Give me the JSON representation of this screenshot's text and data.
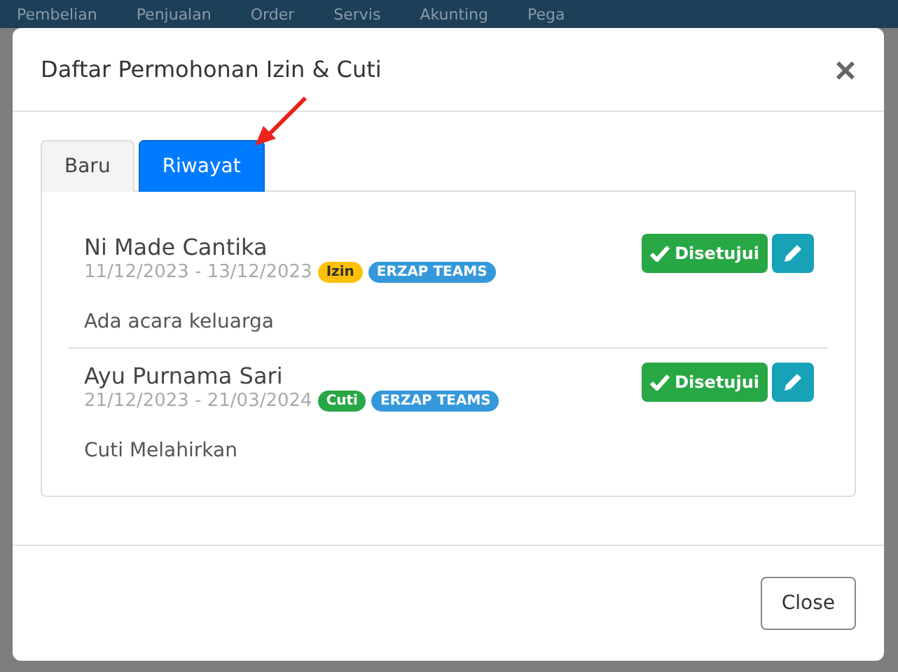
{
  "navbar": {
    "items": [
      "Pembelian",
      "Penjualan",
      "Order",
      "Servis",
      "Akunting",
      "Pega"
    ]
  },
  "modal": {
    "title": "Daftar Permohonan Izin & Cuti",
    "close_symbol": "×",
    "tabs": [
      {
        "label": "Baru",
        "selected": false
      },
      {
        "label": "Riwayat",
        "selected": true
      }
    ],
    "requests": [
      {
        "name": "Ni Made Cantika",
        "dates": "11/12/2023 - 13/12/2023",
        "type_badge": {
          "label": "Izin",
          "color": "#ffc107"
        },
        "team_badge": "ERZAP TEAMS",
        "status": "Disetujui",
        "note": "Ada acara keluarga"
      },
      {
        "name": "Ayu Purnama Sari",
        "dates": "21/12/2023 - 21/03/2024",
        "type_badge": {
          "label": "Cuti",
          "color": "#28a745"
        },
        "team_badge": "ERZAP TEAMS",
        "status": "Disetujui",
        "note": "Cuti Melahirkan"
      }
    ],
    "footer_button": "Close"
  }
}
